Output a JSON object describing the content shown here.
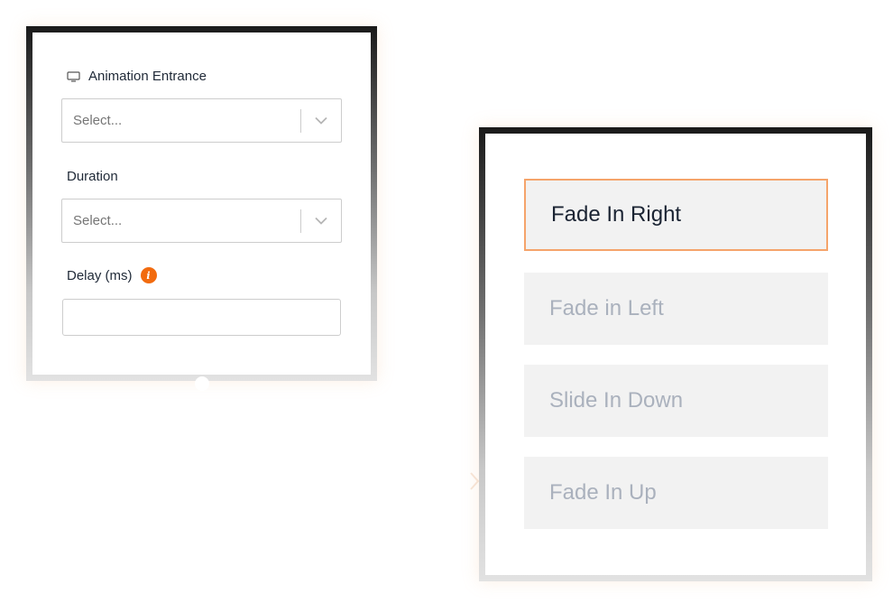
{
  "animation_panel": {
    "entrance_label": "Animation Entrance",
    "entrance_placeholder": "Select...",
    "duration_label": "Duration",
    "duration_placeholder": "Select...",
    "delay_label": "Delay (ms)",
    "delay_value": "",
    "info_glyph": "i",
    "icons": {
      "entrance": "monitor-icon",
      "select_arrow": "chevron-down-icon",
      "delay_info": "info-icon"
    }
  },
  "animation_options": {
    "items": [
      {
        "label": "Fade In Right",
        "selected": true
      },
      {
        "label": "Fade in Left",
        "selected": false
      },
      {
        "label": "Slide In Down",
        "selected": false
      },
      {
        "label": "Fade In Up",
        "selected": false
      }
    ]
  },
  "colors": {
    "accent": "#f26b0f",
    "selected_border": "#f5a46b",
    "option_bg": "#f2f2f2",
    "option_text": "#aab1bd",
    "selected_text": "#1b2433"
  }
}
